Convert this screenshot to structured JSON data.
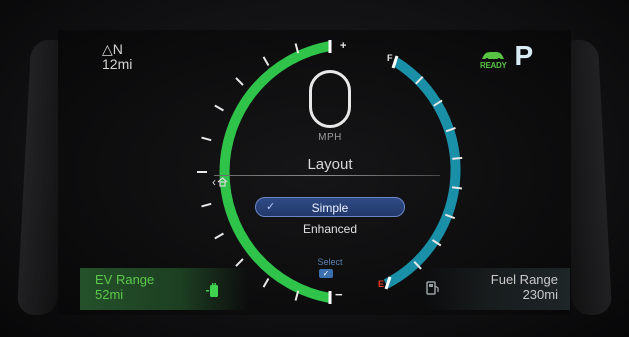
{
  "navigation": {
    "direction": "△N",
    "distance": "12mi"
  },
  "status": {
    "ready_label": "READY",
    "gear": "P"
  },
  "ev_range": {
    "label": "EV Range",
    "value": "52mi"
  },
  "fuel_range": {
    "label": "Fuel Range",
    "value": "230mi"
  },
  "speedometer": {
    "unit": "MPH",
    "power_plus": "+",
    "power_minus": "−",
    "power_level": 0.95
  },
  "fuel_gauge": {
    "full_label": "F",
    "empty_label": "E",
    "level": 1.0
  },
  "menu": {
    "title": "Layout",
    "back_icon": "back-home-icon",
    "options": [
      {
        "label": "Simple",
        "selected": true
      },
      {
        "label": "Enhanced",
        "selected": false
      }
    ],
    "hint": "Select"
  },
  "colors": {
    "ev_green": "#2fc34a",
    "fuel_teal": "#1a8fa8",
    "selection_blue": "#2b4580"
  },
  "icons": {
    "ready": "car-icon",
    "ev": "plug-icon",
    "fuel": "fuel-pump-icon"
  }
}
